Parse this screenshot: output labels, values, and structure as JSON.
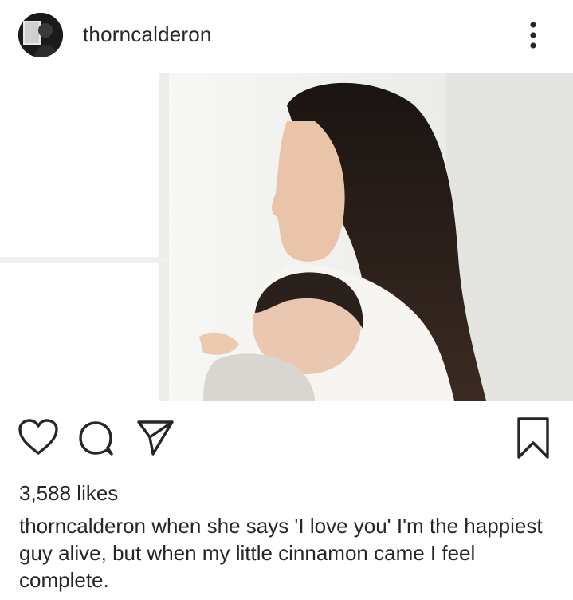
{
  "post": {
    "username": "thorncalderon",
    "image_alt": "woman holding sleeping newborn by window",
    "likes": "3,588 likes",
    "caption_user": "thorncalderon",
    "caption_text": " when she says 'I love you' I'm the happiest guy alive, but when my little cinnamon came I feel complete."
  },
  "icons": {
    "more": "more-options-icon",
    "like": "heart-icon",
    "comment": "comment-icon",
    "share": "paper-plane-icon",
    "save": "bookmark-icon"
  },
  "colors": {
    "text": "#262626",
    "background": "#ffffff"
  }
}
